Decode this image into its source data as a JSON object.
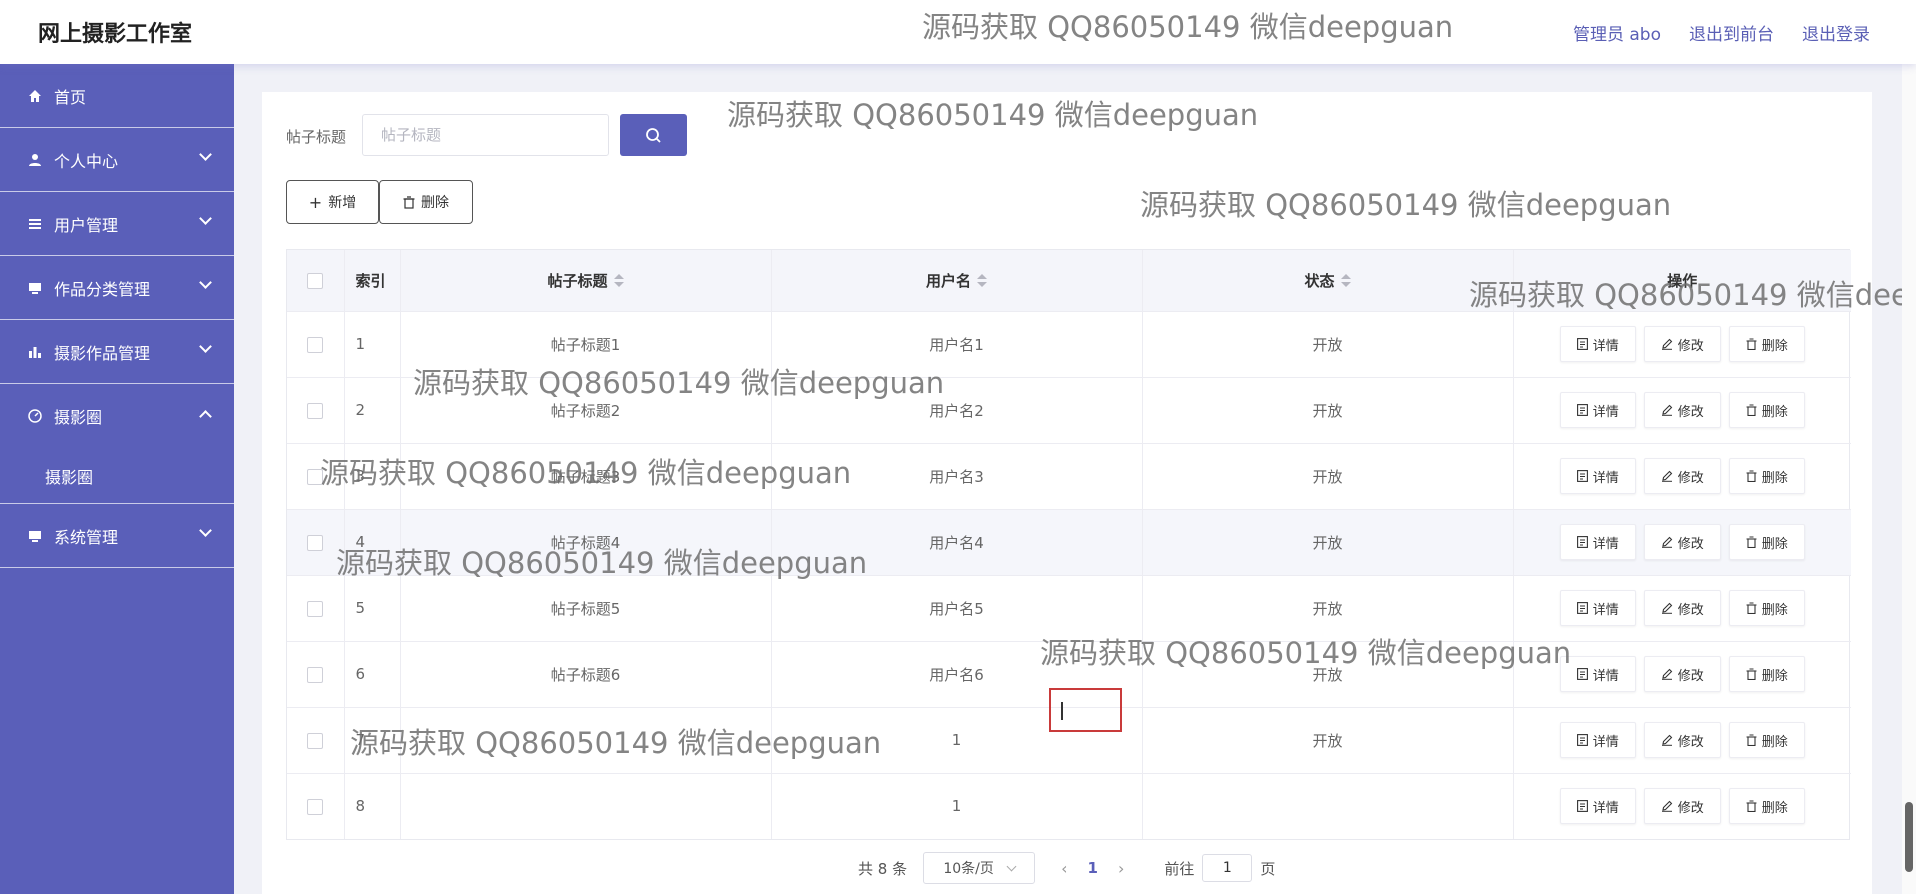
{
  "header": {
    "brand": "网上摄影工作室",
    "nav": [
      "管理员 abo",
      "退出到前台",
      "退出登录"
    ]
  },
  "sidebar": {
    "items": [
      {
        "label": "首页",
        "icon": "home-icon"
      },
      {
        "label": "个人中心",
        "icon": "user-icon"
      },
      {
        "label": "用户管理",
        "icon": "list-icon"
      },
      {
        "label": "作品分类管理",
        "icon": "monitor-icon"
      },
      {
        "label": "摄影作品管理",
        "icon": "bar-chart-icon"
      },
      {
        "label": "摄影圈",
        "icon": "gauge-icon",
        "expanded": true
      },
      {
        "label": "系统管理",
        "icon": "monitor-icon"
      }
    ],
    "sub": "摄影圈"
  },
  "search": {
    "label": "帖子标题",
    "placeholder": "帖子标题"
  },
  "toolbar": {
    "add": "新增",
    "delete": "删除"
  },
  "table": {
    "columns": [
      "索引",
      "帖子标题",
      "用户名",
      "状态",
      "操作"
    ],
    "rows": [
      {
        "idx": "1",
        "title": "帖子标题1",
        "user": "用户名1",
        "status": "开放"
      },
      {
        "idx": "2",
        "title": "帖子标题2",
        "user": "用户名2",
        "status": "开放"
      },
      {
        "idx": "3",
        "title": "帖子标题3",
        "user": "用户名3",
        "status": "开放"
      },
      {
        "idx": "4",
        "title": "帖子标题4",
        "user": "用户名4",
        "status": "开放"
      },
      {
        "idx": "5",
        "title": "帖子标题5",
        "user": "用户名5",
        "status": "开放"
      },
      {
        "idx": "6",
        "title": "帖子标题6",
        "user": "用户名6",
        "status": "开放"
      },
      {
        "idx": "7",
        "title": "",
        "user": "1",
        "status": "开放"
      },
      {
        "idx": "8",
        "title": "",
        "user": "1",
        "status": ""
      }
    ],
    "ops": {
      "detail": "详情",
      "edit": "修改",
      "delete": "删除"
    }
  },
  "pager": {
    "total": "共 8 条",
    "size": "10条/页",
    "current": "1",
    "goto_prefix": "前往",
    "goto_value": "1",
    "goto_suffix": "页"
  },
  "watermark": "源码获取 QQ86050149 微信deepguan",
  "colors": {
    "sidebar": "#5a5fb9",
    "accent": "#5a5fb9",
    "header_text": "#5a5fb5"
  }
}
